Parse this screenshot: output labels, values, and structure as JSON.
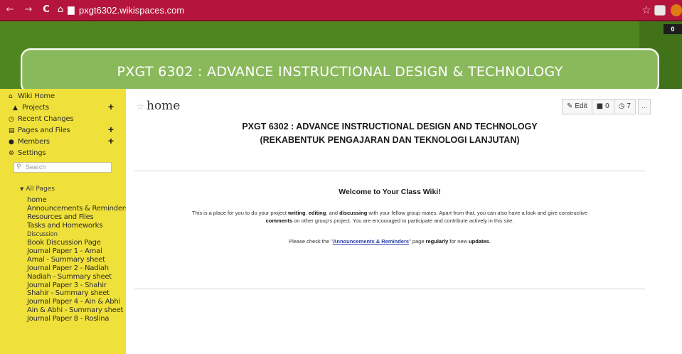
{
  "browser": {
    "url": "pxgt6302.wikispaces.com",
    "extension_badge": "0"
  },
  "header": {
    "title": "PXGT 6302  :  ADVANCE INSTRUCTIONAL DESIGN & TECHNOLOGY"
  },
  "sidebar": {
    "nav": [
      {
        "label": "Wiki Home",
        "icon": "home-icon"
      },
      {
        "label": "Projects",
        "icon": "projects-icon"
      },
      {
        "label": "Recent Changes",
        "icon": "clock-icon"
      },
      {
        "label": "Pages and Files",
        "icon": "files-icon"
      },
      {
        "label": "Members",
        "icon": "members-icon"
      },
      {
        "label": "Settings",
        "icon": "gear-icon"
      }
    ],
    "search_placeholder": "Search",
    "all_pages_label": "All Pages",
    "pages": [
      "home",
      "Announcements & Reminders",
      "Resources and Files",
      "Tasks and Homeworks",
      "Discussion",
      "Book Discussion Page",
      "Journal Paper 1 - Amal",
      "Amal - Summary sheet",
      "Journal Paper 2 - Nadiah",
      "Nadiah - Summary sheet",
      "Journal Paper 3 - Shahir",
      "Shahir - Summary sheet",
      "Journal Paper 4 - Ain & Abhi",
      "Ain & Abhi - Summary sheet",
      "Journal Paper 8 - Roslina"
    ]
  },
  "page": {
    "title": "home",
    "toolbar": {
      "edit_label": "Edit",
      "comments_count": "0",
      "history_count": "7",
      "more_label": "..."
    },
    "heading_line1": "PXGT 6302 : ADVANCE INSTRUCTIONAL DESIGN AND TECHNOLOGY",
    "heading_line2": "(REKABENTUK PENGAJARAN DAN TEKNOLOGI LANJUTAN)",
    "welcome": "Welcome to Your Class Wiki!",
    "para1": {
      "t1": "This is a place for you to do your project ",
      "b1": "writing",
      "t2": ", ",
      "b2": "editing",
      "t3": ", and ",
      "b3": "discussing",
      "t4": " with your fellow group mates. Apart from that, you can also have a look and give constructive",
      "b4": "comments",
      "t5": " on other group's project. You are encouraged to participate and contribute actively in this site."
    },
    "para2": {
      "t1": "Please check the \"",
      "link": "Announcements & Reminders",
      "t2": "\" page ",
      "b1": "regularly",
      "t3": " for new ",
      "b2": "updates",
      "t4": "."
    }
  }
}
